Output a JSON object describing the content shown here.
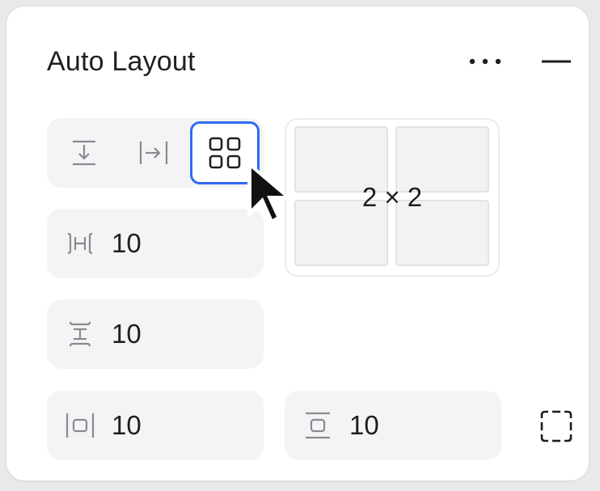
{
  "panel": {
    "title": "Auto Layout",
    "more_icon": "more-horizontal-icon",
    "collapse_icon": "minus-icon"
  },
  "direction": {
    "options": [
      {
        "name": "vertical",
        "icon": "arrow-down-to-line-icon",
        "selected": false
      },
      {
        "name": "horizontal",
        "icon": "arrow-right-to-line-icon",
        "selected": false
      },
      {
        "name": "grid",
        "icon": "grid-2x2-icon",
        "selected": true
      }
    ],
    "accent_color": "#2f6bf5"
  },
  "grid_preview": {
    "label": "2 × 2",
    "rows": 2,
    "columns": 2
  },
  "fields": {
    "horizontal_gap": {
      "value": "10",
      "icon": "horizontal-gap-icon"
    },
    "vertical_gap": {
      "value": "10",
      "icon": "vertical-gap-icon"
    },
    "horizontal_padding": {
      "value": "10",
      "icon": "horizontal-padding-icon"
    },
    "vertical_padding": {
      "value": "10",
      "icon": "vertical-padding-icon"
    }
  },
  "clip_content": {
    "icon": "clip-content-icon"
  }
}
